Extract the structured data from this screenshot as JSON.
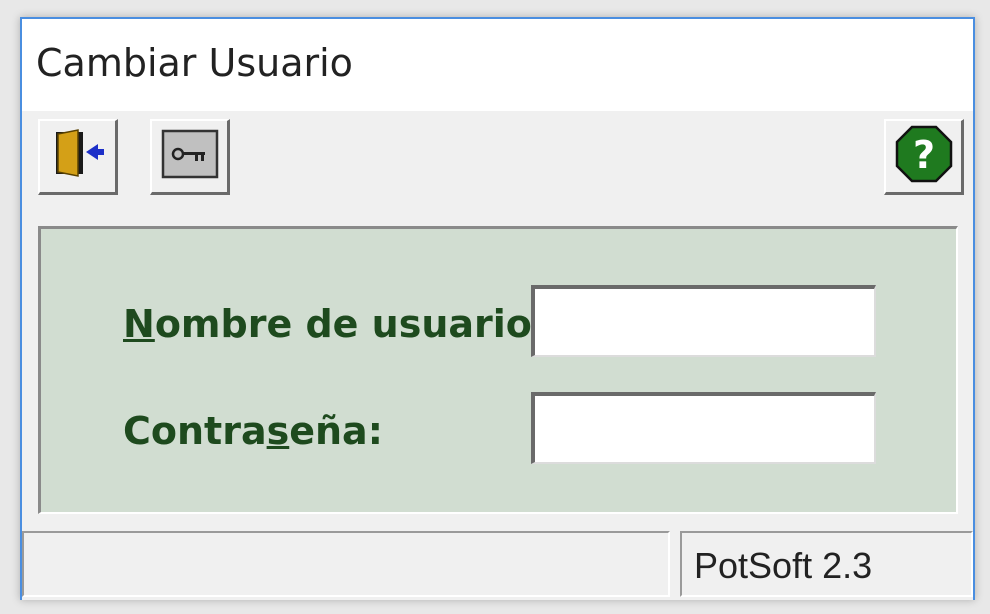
{
  "window": {
    "title": "Cambiar Usuario"
  },
  "toolbar": {
    "exit_icon": "door-exit-icon",
    "key_icon": "key-icon",
    "help_icon": "help-question-icon"
  },
  "form": {
    "username": {
      "label_first": "N",
      "label_rest": "ombre de usuario:",
      "value": ""
    },
    "password": {
      "label_pre": "Contra",
      "label_u": "s",
      "label_post": "eña:",
      "value": ""
    }
  },
  "status": {
    "left": "",
    "right": "PotSoft 2.3"
  },
  "colors": {
    "panel_bg": "#d1ddd1",
    "label_text": "#1e4a1e",
    "window_border": "#4a8ee0",
    "help_green": "#1f7a1f"
  }
}
